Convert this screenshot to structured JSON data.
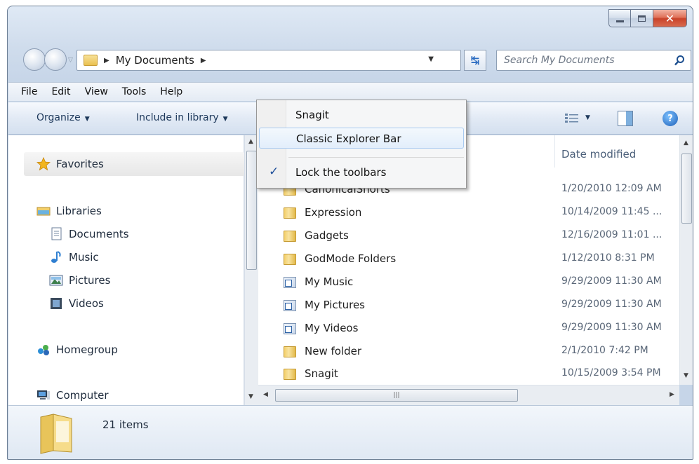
{
  "window": {
    "caption_buttons": [
      "minimize",
      "maximize",
      "close"
    ]
  },
  "address_bar": {
    "breadcrumb": "My Documents",
    "search_placeholder": "Search My Documents"
  },
  "menu_bar": [
    "File",
    "Edit",
    "View",
    "Tools",
    "Help"
  ],
  "command_bar": {
    "organize": "Organize",
    "include_in_library": "Include in library"
  },
  "nav_pane": {
    "favorites": "Favorites",
    "libraries": "Libraries",
    "library_items": [
      "Documents",
      "Music",
      "Pictures",
      "Videos"
    ],
    "homegroup": "Homegroup",
    "computer": "Computer"
  },
  "file_list": {
    "column_date": "Date modified",
    "rows": [
      {
        "name": "CanonicalShorts",
        "date": "1/20/2010 12:09 AM",
        "icon": "folder-icon"
      },
      {
        "name": "Expression",
        "date": "10/14/2009 11:45 ...",
        "icon": "folder-icon"
      },
      {
        "name": "Gadgets",
        "date": "12/16/2009 11:01 ...",
        "icon": "folder-icon"
      },
      {
        "name": "GodMode Folders",
        "date": "1/12/2010 8:31 PM",
        "icon": "folder-icon"
      },
      {
        "name": "My Music",
        "date": "9/29/2009 11:30 AM",
        "icon": "shortcut-folder-icon"
      },
      {
        "name": "My Pictures",
        "date": "9/29/2009 11:30 AM",
        "icon": "shortcut-folder-icon"
      },
      {
        "name": "My Videos",
        "date": "9/29/2009 11:30 AM",
        "icon": "shortcut-folder-icon"
      },
      {
        "name": "New folder",
        "date": "2/1/2010 7:42 PM",
        "icon": "folder-icon"
      },
      {
        "name": "Snagit",
        "date": "10/15/2009 3:54 PM",
        "icon": "folder-icon"
      }
    ]
  },
  "details_pane": {
    "item_count": "21 items"
  },
  "context_menu": {
    "items": [
      {
        "label": "Snagit",
        "checked": false,
        "highlighted": false
      },
      {
        "label": "Classic Explorer Bar",
        "checked": false,
        "highlighted": true
      },
      {
        "label": "Lock the toolbars",
        "checked": true,
        "highlighted": false
      }
    ],
    "check_glyph": "✓"
  },
  "colors": {
    "accent": "#2a6bc1",
    "close_button": "#c9432a",
    "highlight_border": "#a8caf0"
  }
}
